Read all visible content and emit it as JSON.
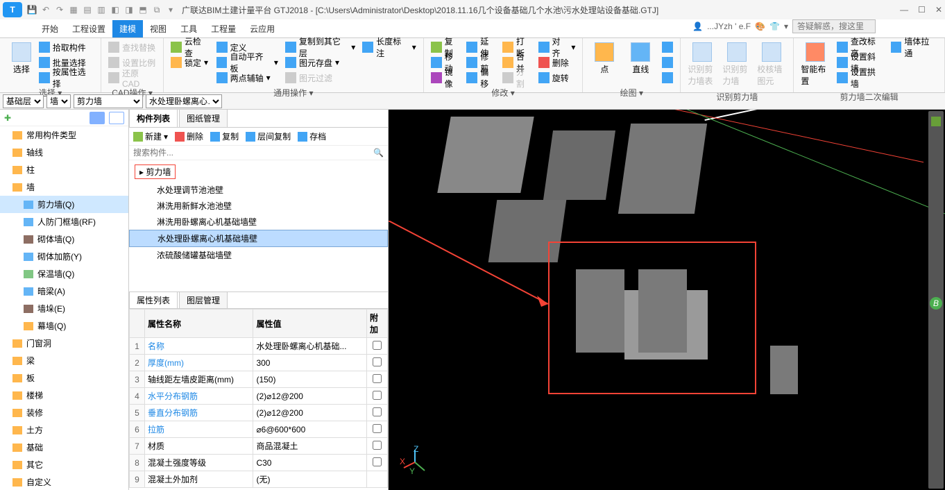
{
  "title": "广联达BIM土建计量平台 GTJ2018 - [C:\\Users\\Administrator\\Desktop\\2018.11.16几个设备基础几个水池\\污水处理站设备基础.GTJ]",
  "user": "...JYzh ' e.F",
  "search_placeholder": "答疑解惑，搜这里",
  "menu": [
    "开始",
    "工程设置",
    "建模",
    "视图",
    "工具",
    "工程量",
    "云应用"
  ],
  "menu_active": 2,
  "ribbon": {
    "select": {
      "big": "选择",
      "items": [
        "拾取构件",
        "批量选择",
        "按属性选择"
      ],
      "name": "选择",
      "arrow": "▾"
    },
    "cad": {
      "items": [
        "查找替换",
        "设置比例",
        "还原CAD"
      ],
      "name": "CAD操作",
      "arrow": "▾"
    },
    "general": {
      "c1": [
        "云检查",
        "锁定"
      ],
      "c2": [
        "定义",
        "自动平齐板",
        "两点辅轴"
      ],
      "c3": [
        "复制到其它层",
        "长度标注",
        "图元存盘",
        "图元过滤"
      ],
      "name": "通用操作",
      "arrow": "▾"
    },
    "modify": {
      "c1": [
        "复制",
        "移动",
        "镜像"
      ],
      "c2": [
        "延伸",
        "修剪",
        "偏移"
      ],
      "c3": [
        "打断",
        "合并",
        "分割"
      ],
      "c4": [
        "对齐",
        "删除",
        "旋转"
      ],
      "name": "修改",
      "arrow": "▾"
    },
    "draw": {
      "items": [
        "点",
        "直线"
      ],
      "name": "绘图",
      "arrow": "▾"
    },
    "ident": {
      "items": [
        "识别剪力墙表",
        "识别剪力墙",
        "校核墙图元"
      ],
      "name": "识别剪力墙"
    },
    "smart": {
      "big": "智能布置",
      "items": [
        "查改标高",
        "设置斜墙",
        "设置拱墙",
        "墙体拉通"
      ],
      "name": "剪力墙二次编辑"
    }
  },
  "combos": [
    "基础层",
    "墙",
    "剪力墙",
    "水处理卧螺离心…"
  ],
  "nav": {
    "root": "常用构件类型",
    "items": [
      "轴线",
      "柱",
      "墙"
    ],
    "wall_sub": [
      {
        "l": "剪力墙(Q)",
        "sel": true
      },
      {
        "l": "人防门框墙(RF)"
      },
      {
        "l": "砌体墙(Q)"
      },
      {
        "l": "砌体加筋(Y)"
      },
      {
        "l": "保温墙(Q)"
      },
      {
        "l": "暗梁(A)"
      },
      {
        "l": "墙垛(E)"
      },
      {
        "l": "幕墙(Q)"
      }
    ],
    "rest": [
      "门窗洞",
      "梁",
      "板",
      "楼梯",
      "装修",
      "土方",
      "基础",
      "其它",
      "自定义"
    ]
  },
  "comp": {
    "tabs": [
      "构件列表",
      "图纸管理"
    ],
    "toolbar": [
      "新建",
      "删除",
      "复制",
      "层间复制",
      "存档"
    ],
    "search": "搜索构件...",
    "header": "剪力墙",
    "items": [
      "水处理调节池池壁",
      "淋洗用新鲜水池池壁",
      "淋洗用卧螺离心机基础墙壁",
      "水处理卧螺离心机基础墙壁",
      "浓硫酸储罐基础墙壁"
    ],
    "sel": 3
  },
  "prop": {
    "tabs": [
      "属性列表",
      "图层管理"
    ],
    "cols": [
      "属性名称",
      "属性值",
      "附加"
    ],
    "rows": [
      {
        "n": "1",
        "k": "名称",
        "v": "水处理卧螺离心机基础...",
        "link": true
      },
      {
        "n": "2",
        "k": "厚度(mm)",
        "v": "300",
        "link": true
      },
      {
        "n": "3",
        "k": "轴线距左墙皮距离(mm)",
        "v": "(150)"
      },
      {
        "n": "4",
        "k": "水平分布钢筋",
        "v": "(2)⌀12@200",
        "link": true
      },
      {
        "n": "5",
        "k": "垂直分布钢筋",
        "v": "(2)⌀12@200",
        "link": true
      },
      {
        "n": "6",
        "k": "拉筋",
        "v": "⌀6@600*600",
        "link": true
      },
      {
        "n": "7",
        "k": "材质",
        "v": "商品混凝土"
      },
      {
        "n": "8",
        "k": "混凝土强度等级",
        "v": "C30"
      },
      {
        "n": "9",
        "k": "混凝土外加剂",
        "v": "(无)"
      }
    ]
  },
  "axis": {
    "x": "X",
    "y": "Y",
    "z": "Z"
  },
  "badge": "B"
}
